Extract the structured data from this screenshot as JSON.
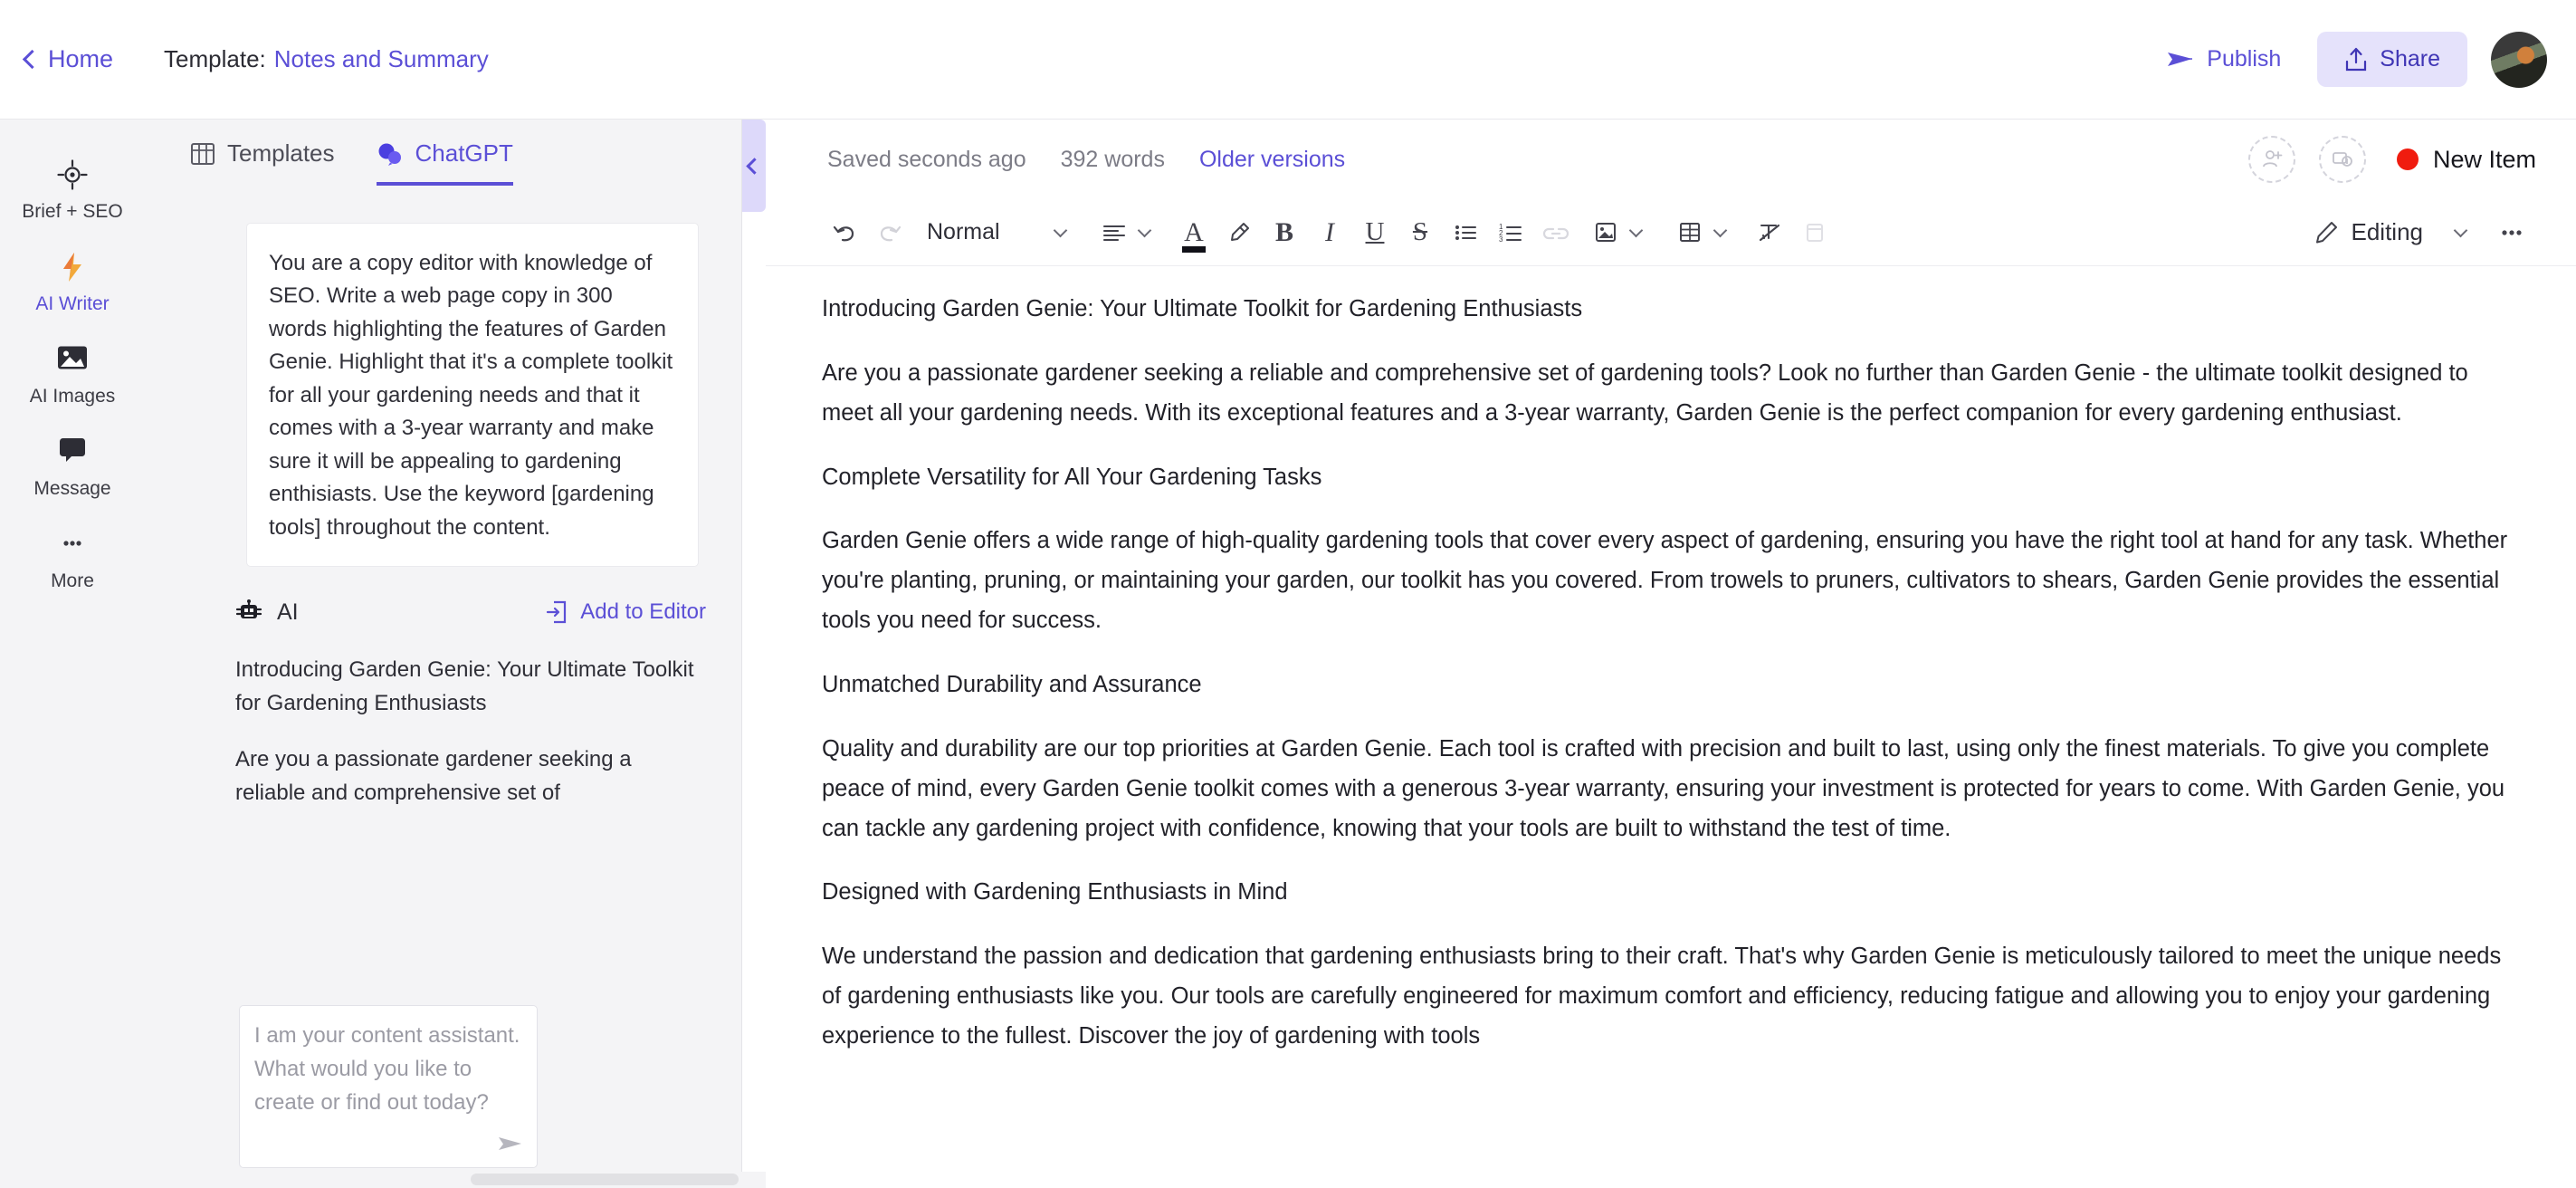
{
  "topbar": {
    "home_label": "Home",
    "template_prefix": "Template:",
    "template_name": "Notes and Summary",
    "publish_label": "Publish",
    "share_label": "Share",
    "accent_color": "#5b4fd6",
    "share_bg": "#e5e2fb"
  },
  "rail": {
    "items": [
      {
        "label": "Brief + SEO",
        "icon": "target-icon",
        "active": false
      },
      {
        "label": "AI Writer",
        "icon": "lightning-icon",
        "active": true
      },
      {
        "label": "AI Images",
        "icon": "image-icon",
        "active": false
      },
      {
        "label": "Message",
        "icon": "chat-bubble-icon",
        "active": false
      },
      {
        "label": "More",
        "icon": "ellipsis-icon",
        "active": false
      }
    ]
  },
  "panel": {
    "tabs": [
      {
        "label": "Templates",
        "icon": "templates-grid-icon",
        "active": false
      },
      {
        "label": "ChatGPT",
        "icon": "chat-bubbles-icon",
        "active": true
      }
    ],
    "prompt": "You are a copy editor with knowledge of SEO. Write a web page copy in 300 words highlighting the features of Garden Genie. Highlight that it's a complete toolkit for all your gardening needs and that it comes with a 3-year warranty and make sure it will be appealing to gardening enthisiasts. Use the keyword [gardening tools] throughout the content.",
    "ai_label": "AI",
    "add_to_editor_label": "Add to Editor",
    "ai_response": [
      "Introducing Garden Genie: Your Ultimate Toolkit for Gardening Enthusiasts",
      "Are you a passionate gardener seeking a reliable and comprehensive set of"
    ],
    "composer_placeholder": "I am your content assistant. What would you like to create or find out today?",
    "composer_value": ""
  },
  "document": {
    "saved_status": "Saved seconds ago",
    "word_count": "392 words",
    "older_versions_label": "Older versions",
    "new_item_label": "New Item",
    "new_item_dot_color": "#f01c0f",
    "toolbar": {
      "style_value": "Normal",
      "editing_label": "Editing",
      "buttons": [
        "undo-icon",
        "redo-icon",
        "align-icon",
        "text-color-icon",
        "highlight-icon",
        "bold-icon",
        "italic-icon",
        "underline-icon",
        "strikethrough-icon",
        "bullet-list-icon",
        "numbered-list-icon",
        "link-icon",
        "image-icon",
        "table-icon",
        "clear-format-icon",
        "insert-icon",
        "edit-pencil-icon",
        "more-options-icon"
      ]
    },
    "paragraphs": [
      "Introducing Garden Genie: Your Ultimate Toolkit for Gardening Enthusiasts",
      "Are you a passionate gardener seeking a reliable and comprehensive set of gardening tools? Look no further than Garden Genie - the ultimate toolkit designed to meet all your gardening needs. With its exceptional features and a 3-year warranty, Garden Genie is the perfect companion for every gardening enthusiast.",
      "Complete Versatility for All Your Gardening Tasks",
      "Garden Genie offers a wide range of high-quality gardening tools that cover every aspect of gardening, ensuring you have the right tool at hand for any task. Whether you're planting, pruning, or maintaining your garden, our toolkit has you covered. From trowels to pruners, cultivators to shears, Garden Genie provides the essential tools you need for success.",
      "Unmatched Durability and Assurance",
      "Quality and durability are our top priorities at Garden Genie. Each tool is crafted with precision and built to last, using only the finest materials. To give you complete peace of mind, every Garden Genie toolkit comes with a generous 3-year warranty, ensuring your investment is protected for years to come. With Garden Genie, you can tackle any gardening project with confidence, knowing that your tools are built to withstand the test of time.",
      "Designed with Gardening Enthusiasts in Mind",
      "We understand the passion and dedication that gardening enthusiasts bring to their craft. That's why Garden Genie is meticulously tailored to meet the unique needs of gardening enthusiasts like you. Our tools are carefully engineered for maximum comfort and efficiency, reducing fatigue and allowing you to enjoy your gardening experience to the fullest. Discover the joy of gardening with tools"
    ]
  }
}
